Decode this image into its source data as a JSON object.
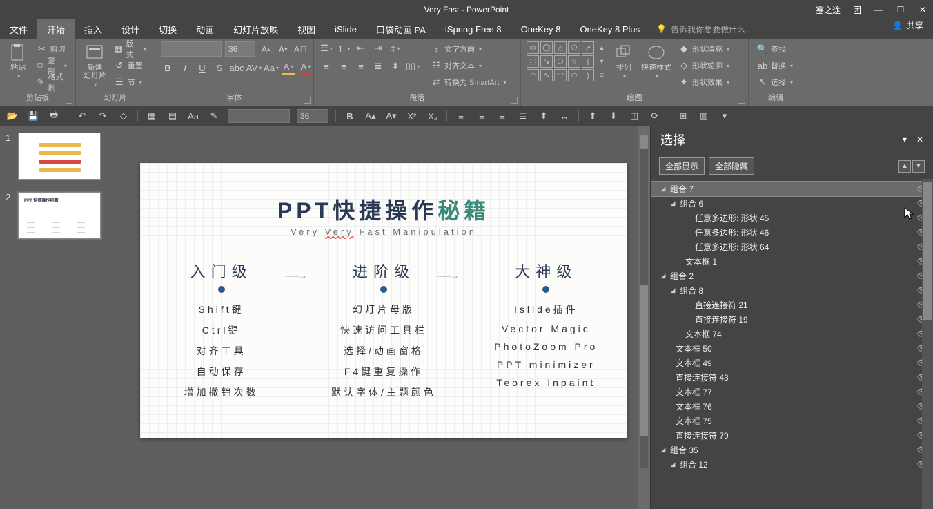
{
  "titlebar": {
    "title": "Very Fast - PowerPoint",
    "user": "塞之途",
    "team": "团"
  },
  "tabs": [
    "文件",
    "开始",
    "插入",
    "设计",
    "切换",
    "动画",
    "幻灯片放映",
    "视图",
    "iSlide",
    "口袋动画 PA",
    "iSpring Free 8",
    "OneKey 8",
    "OneKey 8 Plus"
  ],
  "tabs_active": 1,
  "tellme": "告诉我你想要做什么…",
  "share": "共享",
  "ribbon": {
    "clipboard": {
      "label": "剪贴板",
      "paste": "粘贴",
      "cut": "剪切",
      "copy": "复制",
      "format": "格式刷"
    },
    "slides": {
      "label": "幻灯片",
      "new": "新建\n幻灯片",
      "layout": "版式",
      "reset": "重置",
      "section": "节"
    },
    "font": {
      "label": "字体",
      "size": "36"
    },
    "paragraph": {
      "label": "段落",
      "dir": "文字方向",
      "align": "对齐文本",
      "smartart": "转换为 SmartArt"
    },
    "drawing": {
      "label": "绘图",
      "arrange": "排列",
      "quick": "快速样式",
      "fill": "形状填充",
      "outline": "形状轮廓",
      "effects": "形状效果"
    },
    "editing": {
      "label": "编辑",
      "find": "查找",
      "replace": "替换",
      "select": "选择"
    }
  },
  "qat": {
    "size": "36"
  },
  "thumbs": [
    1,
    2
  ],
  "thumb_selected": 2,
  "slide": {
    "title_a": "PPT快捷操作",
    "title_b": "秘籍",
    "subtitle_a": "Very ",
    "subtitle_b": "Very",
    "subtitle_c": " Fast Manipulation",
    "cols": [
      {
        "h": "入门级",
        "items": [
          "Shift键",
          "Ctrl键",
          "对齐工具",
          "自动保存",
          "增加撤销次数"
        ]
      },
      {
        "h": "进阶级",
        "items": [
          "幻灯片母版",
          "快速访问工具栏",
          "选择/动画窗格",
          "F4键重复操作",
          "默认字体/主题颜色"
        ]
      },
      {
        "h": "大神级",
        "items": [
          "Islide插件",
          "Vector Magic",
          "PhotoZoom Pro",
          "PPT minimizer",
          "Teorex Inpaint"
        ]
      }
    ]
  },
  "selpane": {
    "title": "选择",
    "showall": "全部显示",
    "hideall": "全部隐藏",
    "items": [
      {
        "pad": 12,
        "tog": "◢",
        "label": "组合 7",
        "sel": true
      },
      {
        "pad": 26,
        "tog": "◢",
        "label": "组合 6"
      },
      {
        "pad": 48,
        "tog": "",
        "label": "任意多边形: 形状 45"
      },
      {
        "pad": 48,
        "tog": "",
        "label": "任意多边形: 形状 46"
      },
      {
        "pad": 48,
        "tog": "",
        "label": "任意多边形: 形状 64"
      },
      {
        "pad": 34,
        "tog": "",
        "label": "文本框 1"
      },
      {
        "pad": 12,
        "tog": "◢",
        "label": "组合 2"
      },
      {
        "pad": 26,
        "tog": "◢",
        "label": "组合 8"
      },
      {
        "pad": 48,
        "tog": "",
        "label": "直接连接符 21"
      },
      {
        "pad": 48,
        "tog": "",
        "label": "直接连接符 19"
      },
      {
        "pad": 34,
        "tog": "",
        "label": "文本框 74"
      },
      {
        "pad": 20,
        "tog": "",
        "label": "文本框 50"
      },
      {
        "pad": 20,
        "tog": "",
        "label": "文本框 49"
      },
      {
        "pad": 20,
        "tog": "",
        "label": "直接连接符 43"
      },
      {
        "pad": 20,
        "tog": "",
        "label": "文本框 77"
      },
      {
        "pad": 20,
        "tog": "",
        "label": "文本框 76"
      },
      {
        "pad": 20,
        "tog": "",
        "label": "文本框 75"
      },
      {
        "pad": 20,
        "tog": "",
        "label": "直接连接符 79"
      },
      {
        "pad": 12,
        "tog": "◢",
        "label": "组合 35"
      },
      {
        "pad": 26,
        "tog": "◢",
        "label": "组合 12"
      }
    ]
  }
}
